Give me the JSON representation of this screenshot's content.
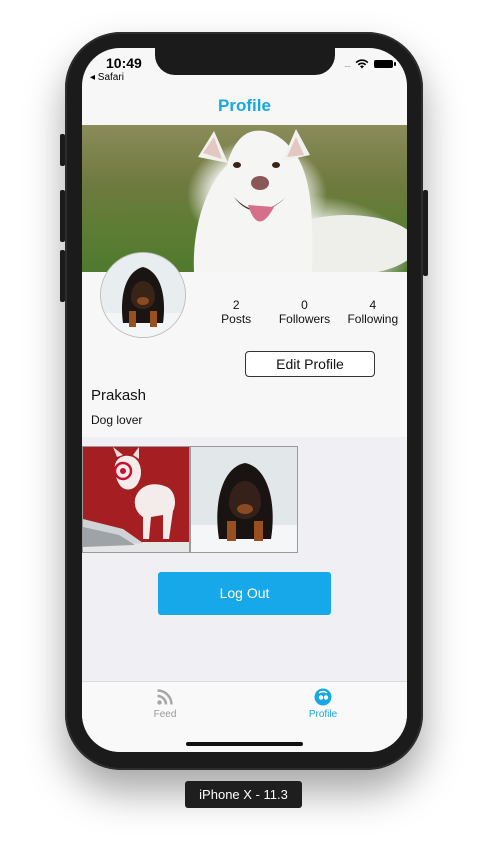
{
  "status": {
    "time": "10:49",
    "back_label": "◂ Safari",
    "signal": "....",
    "wifi_icon": "wifi-icon",
    "battery_icon": "battery-icon"
  },
  "header": {
    "title": "Profile"
  },
  "profile": {
    "cover_image": "white-dog-photo",
    "avatar_image": "black-mastiff-photo",
    "stats": [
      {
        "value": "2",
        "label": "Posts"
      },
      {
        "value": "0",
        "label": "Followers"
      },
      {
        "value": "4",
        "label": "Following"
      }
    ],
    "edit_label": "Edit Profile",
    "name": "Prakash",
    "bio": "Dog lover"
  },
  "gallery": [
    {
      "image": "bull-terrier-target-photo"
    },
    {
      "image": "black-mastiff-photo"
    }
  ],
  "logout_label": "Log Out",
  "tabs": [
    {
      "label": "Feed",
      "icon": "rss-icon",
      "active": false
    },
    {
      "label": "Profile",
      "icon": "profile-icon",
      "active": true
    }
  ],
  "colors": {
    "accent": "#16a8e0",
    "button": "#16a8e8"
  },
  "device_label": "iPhone X - 11.3"
}
